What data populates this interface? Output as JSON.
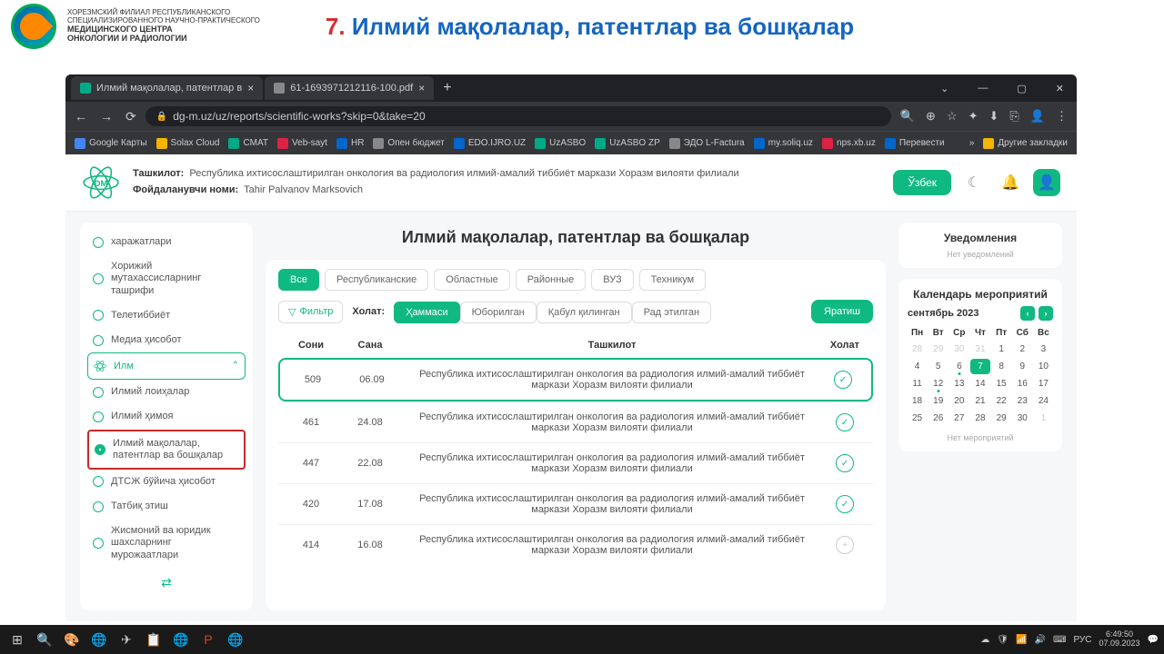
{
  "slide": {
    "org_line1": "ХОРЕЗМСКИЙ ФИЛИАЛ РЕСПУБЛИКАНСКОГО",
    "org_line2": "СПЕЦИАЛИЗИРОВАННОГО НАУЧНО-ПРАКТИЧЕСКОГО",
    "org_bold1": "МЕДИЦИНСКОГО ЦЕНТРА",
    "org_bold2": "ОНКОЛОГИИ И РАДИОЛОГИИ",
    "title_num": "7.",
    "title_text": "Илмий мақолалар, патентлар ва бошқалар"
  },
  "browser": {
    "tabs": [
      {
        "label": "Илмий мақолалар, патентлар в",
        "icon": "#0a8"
      },
      {
        "label": "61-1693971212116-100.pdf",
        "icon": "#888"
      }
    ],
    "url": "dg-m.uz/uz/reports/scientific-works?skip=0&take=20",
    "bookmarks": [
      "Google Карты",
      "Solax Cloud",
      "CMAT",
      "Veb-sayt",
      "HR",
      "Опен бюджет",
      "EDO.IJRO.UZ",
      "UzASBO",
      "UzASBO ZP",
      "ЭДО L-Factura",
      "my.soliq.uz",
      "nps.xb.uz",
      "Перевести"
    ],
    "bm_more": "Другие закладки"
  },
  "app": {
    "org_label": "Ташкилот:",
    "org_value": "Республика ихтисослаштирилган онкология ва радиология илмий-амалий тиббиёт маркази Хоразм вилояти филиали",
    "user_label": "Фойдаланувчи номи:",
    "user_value": "Tahir Palvanov Marksovich",
    "lang_btn": "Ўзбек"
  },
  "sidebar": {
    "items": [
      {
        "label": "харажатлари"
      },
      {
        "label": "Хорижий мутахассисларнинг ташрифи"
      },
      {
        "label": "Телетиббиёт"
      },
      {
        "label": "Медиа ҳисобот"
      },
      {
        "label": "Илм",
        "section": true
      },
      {
        "label": "Илмий лоиҳалар"
      },
      {
        "label": "Илмий ҳимоя"
      },
      {
        "label": "Илмий мақолалар, патентлар ва бошқалар",
        "highlighted": true
      },
      {
        "label": "ДТСЖ бўйича ҳисобот"
      },
      {
        "label": "Татбиқ этиш"
      },
      {
        "label": "Жисмоний ва юридик шахсларнинг мурожаатлари"
      }
    ]
  },
  "main": {
    "title": "Илмий мақолалар, патентлар ва бошқалар",
    "scope_pills": [
      "Все",
      "Республиканские",
      "Областные",
      "Районные",
      "ВУЗ",
      "Техникум"
    ],
    "filter_btn": "Фильтр",
    "status_label": "Холат:",
    "status_pills": [
      "Ҳаммаси",
      "Юборилган",
      "Қабул қилинган",
      "Рад этилган"
    ],
    "create_btn": "Яратиш",
    "columns": {
      "soni": "Сони",
      "sana": "Сана",
      "org": "Ташкилот",
      "status": "Холат"
    },
    "rows": [
      {
        "soni": "509",
        "sana": "06.09",
        "org": "Республика ихтисослаштирилган онкология ва радиология илмий-амалий тиббиёт маркази Хоразм вилояти филиали",
        "ok": true,
        "hl": true
      },
      {
        "soni": "461",
        "sana": "24.08",
        "org": "Республика ихтисослаштирилган онкология ва радиология илмий-амалий тиббиёт маркази Хоразм вилояти филиали",
        "ok": true
      },
      {
        "soni": "447",
        "sana": "22.08",
        "org": "Республика ихтисослаштирилган онкология ва радиология илмий-амалий тиббиёт маркази Хоразм вилояти филиали",
        "ok": true
      },
      {
        "soni": "420",
        "sana": "17.08",
        "org": "Республика ихтисослаштирилган онкология ва радиология илмий-амалий тиббиёт маркази Хоразм вилояти филиали",
        "ok": true
      },
      {
        "soni": "414",
        "sana": "16.08",
        "org": "Республика ихтисослаштирилган онкология ва радиология илмий-амалий тиббиёт маркази Хоразм вилояти филиали",
        "ok": false
      }
    ]
  },
  "notifications": {
    "title": "Уведомления",
    "empty": "Нет уведомлений"
  },
  "calendar": {
    "title": "Календарь мероприятий",
    "month": "сентябрь 2023",
    "dow": [
      "Пн",
      "Вт",
      "Ср",
      "Чт",
      "Пт",
      "Сб",
      "Вс"
    ],
    "days": [
      {
        "n": "28",
        "dim": true
      },
      {
        "n": "29",
        "dim": true
      },
      {
        "n": "30",
        "dim": true
      },
      {
        "n": "31",
        "dim": true
      },
      {
        "n": "1"
      },
      {
        "n": "2"
      },
      {
        "n": "3"
      },
      {
        "n": "4"
      },
      {
        "n": "5"
      },
      {
        "n": "6",
        "dot": true
      },
      {
        "n": "7",
        "today": true
      },
      {
        "n": "8"
      },
      {
        "n": "9"
      },
      {
        "n": "10"
      },
      {
        "n": "11"
      },
      {
        "n": "12",
        "dot": true
      },
      {
        "n": "13"
      },
      {
        "n": "14"
      },
      {
        "n": "15"
      },
      {
        "n": "16"
      },
      {
        "n": "17"
      },
      {
        "n": "18"
      },
      {
        "n": "19"
      },
      {
        "n": "20"
      },
      {
        "n": "21"
      },
      {
        "n": "22"
      },
      {
        "n": "23"
      },
      {
        "n": "24"
      },
      {
        "n": "25"
      },
      {
        "n": "26"
      },
      {
        "n": "27"
      },
      {
        "n": "28"
      },
      {
        "n": "29"
      },
      {
        "n": "30"
      },
      {
        "n": "1",
        "dim": true
      }
    ],
    "empty": "Нет мероприятий"
  },
  "taskbar": {
    "time": "6:49:50",
    "date": "07.09.2023",
    "lang": "РУС"
  }
}
